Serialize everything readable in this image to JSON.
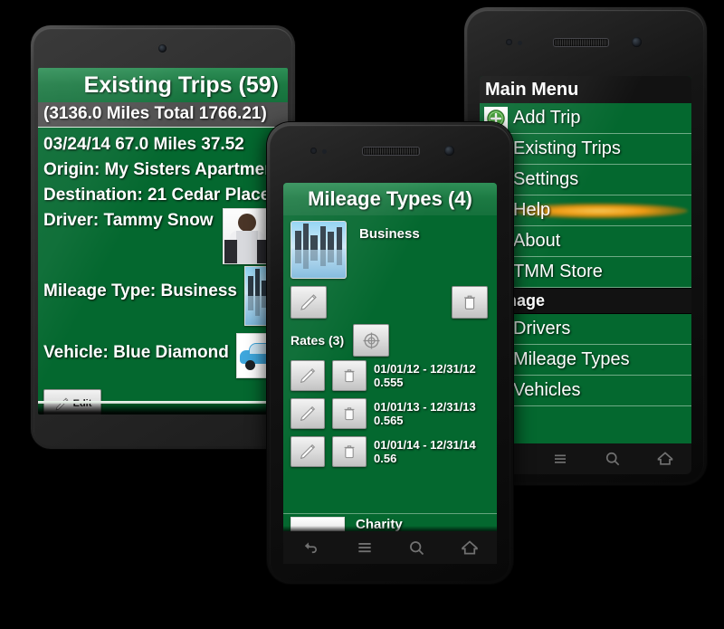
{
  "tablet": {
    "device_name": "android-tablet",
    "app_title": "Existing Trips (59)",
    "summary_bar": "(3136.0 Miles Total 1766.21)",
    "trip": {
      "line1": "03/24/14  67.0 Miles 37.52",
      "origin": "Origin: My Sisters Apartment",
      "destination": "Destination: 21 Cedar Place",
      "driver": "Driver: Tammy Snow",
      "mileage_type": "Mileage Type:  Business",
      "vehicle": "Vehicle:  Blue Diamond",
      "edit_label": "Edit"
    }
  },
  "center_phone": {
    "device_name": "android-phone-center",
    "app_title": "Mileage Types (4)",
    "item_name": "Business",
    "rates_label": "Rates (3)",
    "rates": [
      {
        "period": "01/01/12 - 12/31/12",
        "amount": "0.555"
      },
      {
        "period": "01/01/13 - 12/31/13",
        "amount": "0.565"
      },
      {
        "period": "01/01/14 - 12/31/14",
        "amount": "0.56"
      }
    ],
    "next_item_name": "Charity",
    "nav": [
      "back-icon",
      "menu-icon",
      "search-icon",
      "home-icon"
    ]
  },
  "right_phone": {
    "device_name": "android-phone-right",
    "app_title": "Main Menu",
    "menu_items": [
      {
        "label": "Add Trip",
        "icon": "add-circle-icon",
        "highlighted": false,
        "section": false
      },
      {
        "label": "Existing Trips",
        "icon": "",
        "highlighted": false,
        "section": false
      },
      {
        "label": "Settings",
        "icon": "",
        "highlighted": false,
        "section": false
      },
      {
        "label": "Help",
        "icon": "",
        "highlighted": true,
        "section": false
      },
      {
        "label": "About",
        "icon": "",
        "highlighted": false,
        "section": false
      },
      {
        "label": "TMM Store",
        "icon": "",
        "highlighted": false,
        "section": false
      },
      {
        "label": "Manage",
        "icon": "",
        "highlighted": false,
        "section": true
      },
      {
        "label": "Drivers",
        "icon": "",
        "highlighted": false,
        "section": false
      },
      {
        "label": "Mileage Types",
        "icon": "",
        "highlighted": false,
        "section": false
      },
      {
        "label": "Vehicles",
        "icon": "",
        "highlighted": false,
        "section": false
      }
    ],
    "nav": [
      "menu-icon",
      "search-icon",
      "home-icon"
    ]
  },
  "colors": {
    "app_green": "#04682f",
    "title_green": "#1c7a43",
    "highlight_orange": "#ff9f12",
    "section_dark": "#121212"
  }
}
